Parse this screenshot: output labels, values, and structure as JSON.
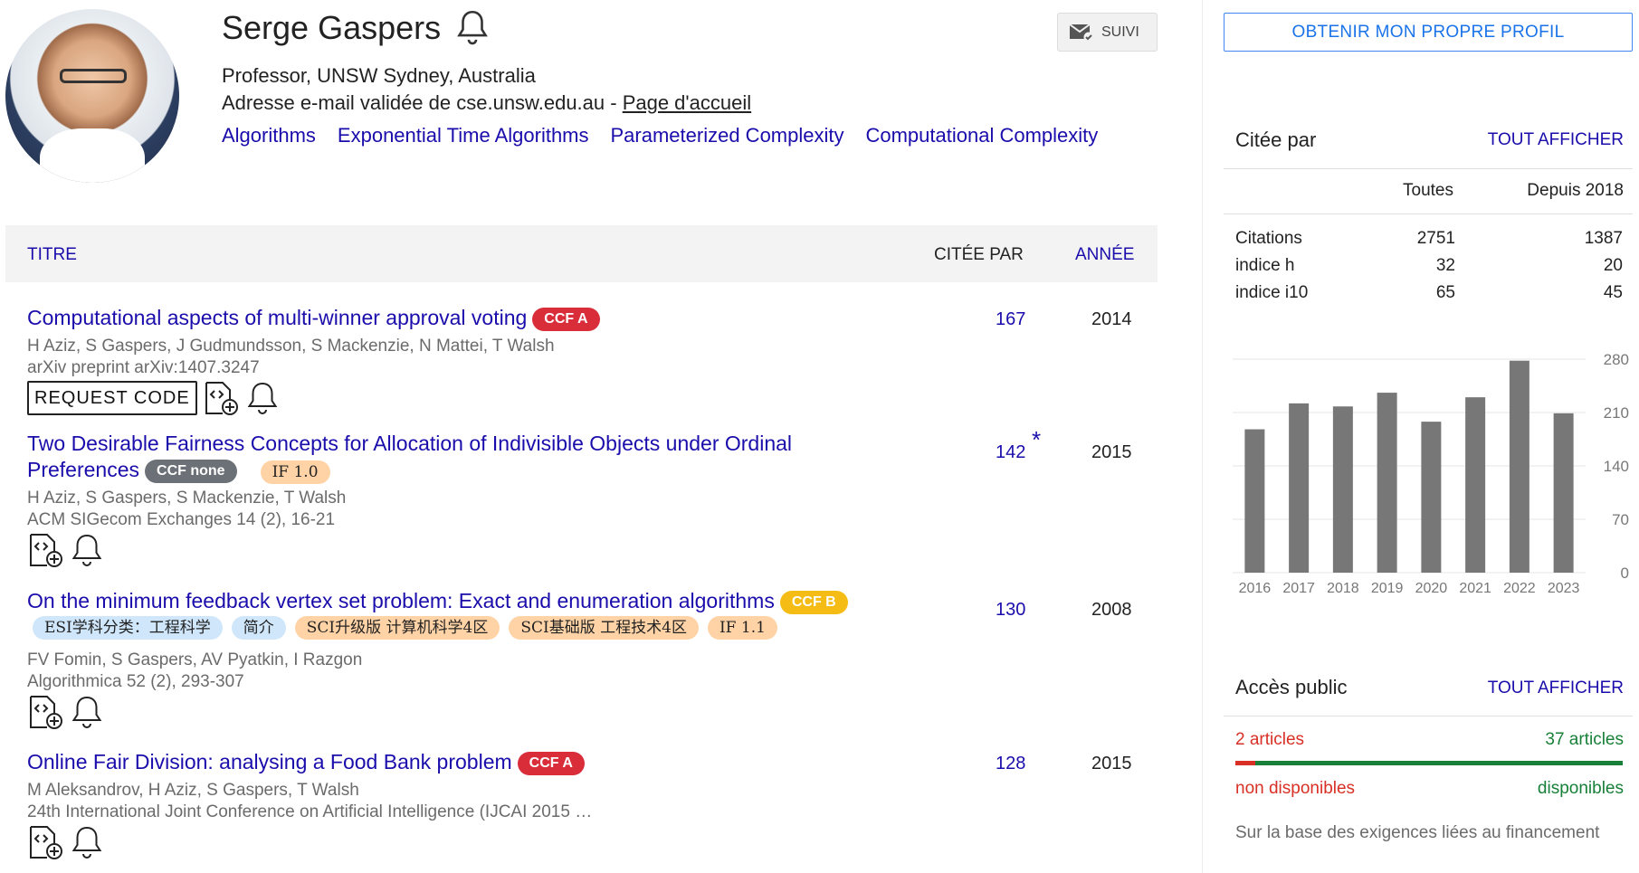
{
  "profile": {
    "name": "Serge Gaspers",
    "affiliation": "Professor, UNSW Sydney, Australia",
    "email_text": "Adresse e-mail validée de cse.unsw.edu.au - ",
    "homepage_link": "Page d'accueil",
    "interests": [
      "Algorithms",
      "Exponential Time Algorithms",
      "Parameterized Complexity",
      "Computational Complexity"
    ],
    "follow_label": "SUIVI"
  },
  "table": {
    "col_title": "TITRE",
    "col_cited": "CITÉE PAR",
    "col_year": "ANNÉE"
  },
  "articles": [
    {
      "title": "Computational aspects of multi-winner approval voting",
      "badge": "CCF A",
      "authors": "H Aziz, S Gaspers, J Gudmundsson, S Mackenzie, N Mattei, T Walsh",
      "venue": "arXiv preprint arXiv:1407.3247",
      "request_code": "REQUEST CODE",
      "cited": "167",
      "year": "2014"
    },
    {
      "title_line1": "Two Desirable Fairness Concepts for Allocation of Indivisible Objects under Ordinal",
      "title_line2": "Preferences",
      "badge": "CCF none",
      "tag": "IF 1.0",
      "authors": "H Aziz, S Gaspers, S Mackenzie, T Walsh",
      "venue": "ACM SIGecom Exchanges 14 (2), 16-21",
      "cited": "142",
      "star": "*",
      "year": "2015"
    },
    {
      "title": "On the minimum feedback vertex set problem: Exact and enumeration algorithms",
      "badge": "CCF B",
      "tags": [
        "ESI学科分类：工程科学",
        "简介",
        "SCI升级版 计算机科学4区",
        "SCI基础版 工程技术4区",
        "IF 1.1"
      ],
      "authors": "FV Fomin, S Gaspers, AV Pyatkin, I Razgon",
      "venue": "Algorithmica 52 (2), 293-307",
      "cited": "130",
      "year": "2008"
    },
    {
      "title": "Online Fair Division: analysing a Food Bank problem",
      "badge": "CCF A",
      "authors": "M Aleksandrov, H Aziz, S Gaspers, T Walsh",
      "venue": "24th International Joint Conference on Artificial Intelligence (IJCAI 2015 …",
      "cited": "128",
      "year": "2015"
    }
  ],
  "sidebar": {
    "own_profile_button": "OBTENIR MON PROPRE PROFIL",
    "cited_by": {
      "heading": "Citée par",
      "view_all": "TOUT AFFICHER",
      "col_all": "Toutes",
      "col_since": "Depuis 2018",
      "rows": [
        {
          "label": "Citations",
          "all": "2751",
          "since": "1387"
        },
        {
          "label": "indice h",
          "all": "32",
          "since": "20"
        },
        {
          "label": "indice i10",
          "all": "65",
          "since": "45"
        }
      ]
    },
    "public_access": {
      "heading": "Accès public",
      "view_all": "TOUT AFFICHER",
      "left_count": "2 articles",
      "right_count": "37 articles",
      "left_label": "non disponibles",
      "right_label": "disponibles",
      "available_fraction": 0.949,
      "note": "Sur la base des exigences liées au financement"
    }
  },
  "chart_data": {
    "type": "bar",
    "categories": [
      "2016",
      "2017",
      "2018",
      "2019",
      "2020",
      "2021",
      "2022",
      "2023"
    ],
    "values": [
      188,
      222,
      218,
      236,
      198,
      230,
      278,
      209
    ],
    "yticks": [
      "0",
      "70",
      "140",
      "210",
      "280"
    ],
    "ylim": [
      0,
      280
    ],
    "grid": true,
    "bar_color": "#777777"
  },
  "colors": {
    "link": "#1a0dab",
    "ccf_a": "#d92d3a",
    "ccf_b": "#f4bc14",
    "ccf_none": "#6c7177",
    "oa_red": "#d93025",
    "oa_green": "#188038"
  }
}
